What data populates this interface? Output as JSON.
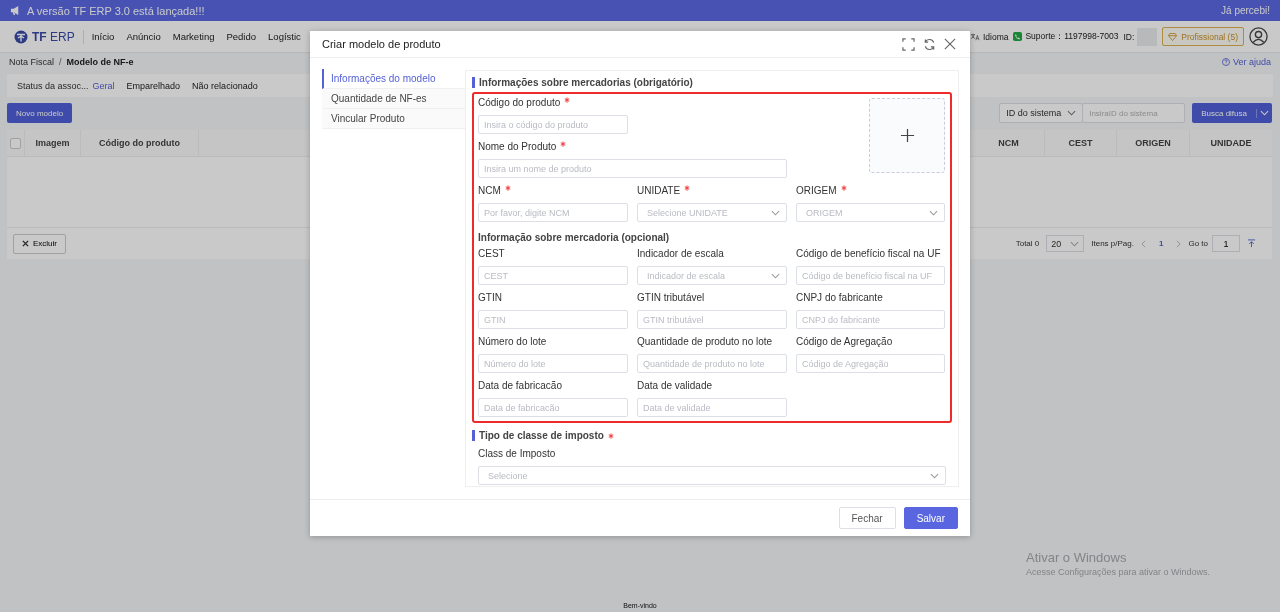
{
  "announcement": {
    "text": "A versão TF ERP 3.0 está lançada!!!",
    "dismiss": "Já percebi!"
  },
  "nav": {
    "logo": "**TF** ERP",
    "items": [
      {
        "label": "Início"
      },
      {
        "label": "Anúncio"
      },
      {
        "label": "Marketing"
      },
      {
        "label": "Pedido"
      },
      {
        "label": "Logístic"
      }
    ],
    "language": "Idioma",
    "support": "Suporte：1197998-7003",
    "id_label": "ID:",
    "plan": "Profissional (5)"
  },
  "breadcrumb": [
    "Nota Fiscal",
    "Modelo de NF-e"
  ],
  "breadcrumb_separator": "/",
  "help": "Ver ajuda",
  "status_filter": {
    "label": "Status da assoc...",
    "options": [
      {
        "label": "Geral",
        "selected": true
      },
      {
        "label": "Emparelhado",
        "selected": false
      },
      {
        "label": "Não relacionado",
        "selected": false
      }
    ]
  },
  "new_button": "Novo modelo",
  "search": {
    "field": "ID do sistema",
    "placeholder": "InsiraID do sistema",
    "button": "Busca difusa"
  },
  "table": {
    "select_all_checked": false,
    "columns_left": [
      "Imagem",
      "Código do produto"
    ],
    "columns_right": [
      "NCM",
      "CEST",
      "ORIGEN",
      "UNIDADE"
    ]
  },
  "delete_button": "Excluir",
  "pagination": {
    "total": "Total 0",
    "page_size": "20",
    "per_page": "Itens p/Pag.",
    "pages": [
      {
        "label": "1",
        "selected": true
      }
    ],
    "goto_label": "Go to",
    "goto_value": "1"
  },
  "modal": {
    "title": "Criar modelo de produto",
    "tabs": [
      {
        "label": "Informações do modelo",
        "selected": true
      },
      {
        "label": "Quantidade de NF-es",
        "selected": false
      },
      {
        "label": "Vincular Produto",
        "selected": false
      }
    ],
    "goods_info": {
      "title": "Informações sobre mercadorias (obrigatório)",
      "highlighted": true,
      "required_rows": [
        [
          {
            "label": "Código do produto",
            "required": true,
            "kind": "input",
            "placeholder": "Insira o código do produto"
          }
        ],
        [
          {
            "label": "Nome do Produto",
            "required": true,
            "kind": "input",
            "placeholder": "Insira um nome de produto"
          }
        ],
        [
          {
            "label": "NCM",
            "required": true,
            "kind": "input",
            "placeholder": "Por favor, digite NCM"
          },
          {
            "label": "UNIDATE",
            "required": true,
            "kind": "select",
            "placeholder": "Selecione UNIDATE"
          },
          {
            "label": "ORIGEM",
            "required": true,
            "kind": "select",
            "placeholder": "ORIGEM"
          }
        ]
      ],
      "optional": {
        "title": "Informação sobre mercadoria (opcional)",
        "rows": [
          [
            {
              "label": "CEST",
              "required": false,
              "kind": "input",
              "placeholder": "CEST"
            },
            {
              "label": "Indicador de escala",
              "required": false,
              "kind": "select",
              "placeholder": "Indicador de escala"
            },
            {
              "label": "Código de benefício fiscal na UF",
              "required": false,
              "kind": "input",
              "placeholder": "Código de benefício fiscal na UF"
            }
          ],
          [
            {
              "label": "GTIN",
              "required": false,
              "kind": "input",
              "placeholder": "GTIN"
            },
            {
              "label": "GTIN tributável",
              "required": false,
              "kind": "input",
              "placeholder": "GTIN tributável"
            },
            {
              "label": "CNPJ do fabricante",
              "required": false,
              "kind": "input",
              "placeholder": "CNPJ do fabricante"
            }
          ],
          [
            {
              "label": "Número do lote",
              "required": false,
              "kind": "input",
              "placeholder": "Número do lote"
            },
            {
              "label": "Quantidade de produto no lote",
              "required": false,
              "kind": "input",
              "placeholder": "Quantidade de produto no lote"
            },
            {
              "label": "Código de Agregação",
              "required": false,
              "kind": "input",
              "placeholder": "Código de Agregação"
            }
          ],
          [
            {
              "label": "Data de fabricacão",
              "required": false,
              "kind": "input",
              "placeholder": "Data de fabricacão"
            },
            {
              "label": "Data de validade",
              "required": false,
              "kind": "input",
              "placeholder": "Data de validade"
            }
          ]
        ]
      }
    },
    "tax_class": {
      "title": "Tipo de classe de imposto",
      "required": true,
      "field": {
        "label": "Class de Imposto",
        "required": false,
        "kind": "select",
        "placeholder": "Selecione"
      }
    },
    "buttons": {
      "cancel": "Fechar",
      "save": "Salvar"
    }
  },
  "footer": "Bem-vindo",
  "os_notice": {
    "title": "Ativar o Windows",
    "text": "Acesse Configurações para ativar o Windows."
  }
}
